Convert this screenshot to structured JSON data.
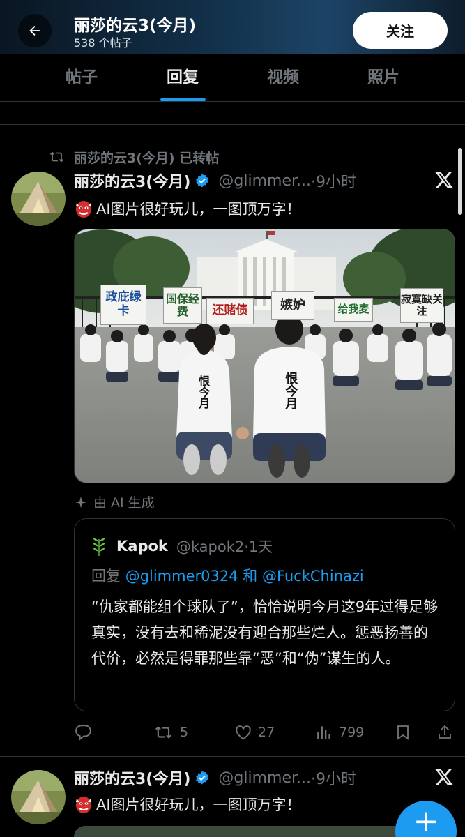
{
  "header": {
    "title": "丽莎的云3(今月)",
    "post_count": "538 个帖子",
    "follow_label": "关注"
  },
  "tabs": [
    {
      "label": "帖子",
      "active": false
    },
    {
      "label": "回复",
      "active": true
    },
    {
      "label": "视频",
      "active": false
    },
    {
      "label": "照片",
      "active": false
    }
  ],
  "post": {
    "repost_label": "丽莎的云3(今月) 已转帖",
    "author_name": "丽莎的云3(今月)",
    "author_handle": "@glimmer...",
    "time": "·9小时",
    "text": "AI图片很好玩儿，一图顶万字！",
    "image_signs": [
      "政庇绿卡",
      "国保经费",
      "还赌债",
      "嫉妒",
      "给我麦",
      "寂寞缺关注"
    ],
    "shirt_text": "恨今月",
    "ai_label": "由 AI 生成",
    "quote": {
      "name": "Kapok",
      "handle": "@kapok2",
      "time": "·1天",
      "reply_prefix": "回复",
      "reply_mentions": "@glimmer0324 和 @FuckChinazi",
      "body": "“仇家都能组个球队了”，恰恰说明今月这9年过得足够真实，没有去和稀泥没有迎合那些烂人。惩恶扬善的代价，必然是得罪那些靠“恶”和“伪”谋生的人。"
    },
    "stats": {
      "replies": "",
      "reposts": "5",
      "likes": "27",
      "views": "799"
    }
  },
  "post2": {
    "author_name": "丽莎的云3(今月)",
    "author_handle": "@glimmer...",
    "time": "·9小时",
    "text": "AI图片很好玩儿，一图顶万字！"
  },
  "colors": {
    "accent": "#1d9bf0",
    "muted": "#71767b",
    "text": "#e7e9ea",
    "border": "#2f3336",
    "verified": "#1d9bf0"
  },
  "icons": [
    "back-arrow-icon",
    "repost-icon",
    "verified-badge-icon",
    "x-logo-icon",
    "mask-emoji-icon",
    "sparkle-icon",
    "plant-emoji-icon",
    "reply-icon",
    "like-icon",
    "views-icon",
    "share-icon",
    "plus-icon"
  ]
}
